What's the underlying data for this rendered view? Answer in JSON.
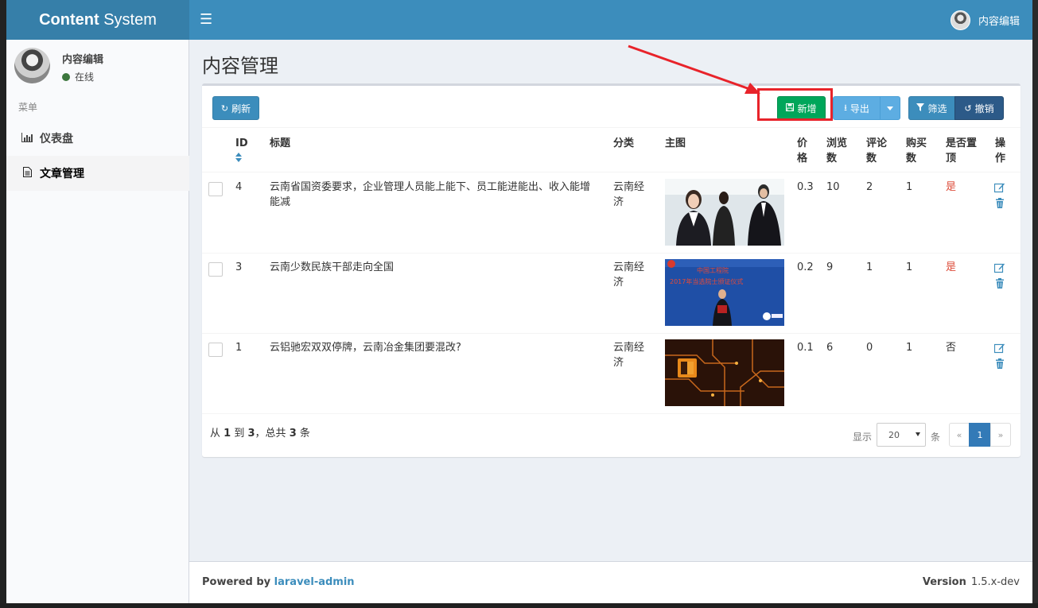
{
  "header": {
    "logo_bold": "Content",
    "logo_rest": " System",
    "user_name": "内容编辑"
  },
  "sidebar": {
    "user_name": "内容编辑",
    "status": "在线",
    "menu_header": "菜单",
    "items": [
      {
        "label": "仪表盘",
        "icon": "bar-chart-icon"
      },
      {
        "label": "文章管理",
        "icon": "file-icon"
      }
    ]
  },
  "page": {
    "title": "内容管理"
  },
  "toolbar": {
    "refresh": "刷新",
    "new": "新增",
    "export": "导出",
    "filter": "筛选",
    "reset": "撤销"
  },
  "table": {
    "headers": {
      "id": "ID",
      "title": "标题",
      "category": "分类",
      "image": "主图",
      "price_a": "价",
      "price_b": "格",
      "views_a": "浏览",
      "views_b": "数",
      "comments_a": "评论",
      "comments_b": "数",
      "buys_a": "购买",
      "buys_b": "数",
      "top_a": "是否置",
      "top_b": "顶",
      "ops_a": "操",
      "ops_b": "作"
    },
    "rows": [
      {
        "id": "4",
        "title": "云南省国资委要求，企业管理人员能上能下、员工能进能出、收入能增能减",
        "category": "云南经济",
        "price": "0.3",
        "views": "10",
        "comments": "2",
        "buys": "1",
        "top": "是"
      },
      {
        "id": "3",
        "title": "云南少数民族干部走向全国",
        "category": "云南经济",
        "price": "0.2",
        "views": "9",
        "comments": "1",
        "buys": "1",
        "top": "是"
      },
      {
        "id": "1",
        "title": "云铝驰宏双双停牌，云南冶金集团要混改?",
        "category": "云南经济",
        "price": "0.1",
        "views": "6",
        "comments": "0",
        "buys": "1",
        "top": "否"
      }
    ],
    "image_texts": {
      "row2_line1": "中国工程院",
      "row2_line2": "2017年当选院士颁证仪式"
    }
  },
  "pagination": {
    "summary_from": "从",
    "summary_start": "1",
    "summary_to": "到",
    "summary_end": "3",
    "summary_total_pre": "，总共",
    "summary_total": "3",
    "summary_unit": "条",
    "show_label": "显示",
    "per_page": "20",
    "per_page_unit": "条",
    "prev": "«",
    "current": "1",
    "next": "»"
  },
  "footer": {
    "powered_by": "Powered by",
    "powered_link": "laravel-admin",
    "version_label": "Version",
    "version": "1.5.x-dev"
  },
  "colors": {
    "header": "#3c8dbc",
    "logo_bg": "#367fa9",
    "success": "#00a65a",
    "danger": "#dd4b39",
    "highlight": "#e8232a"
  }
}
